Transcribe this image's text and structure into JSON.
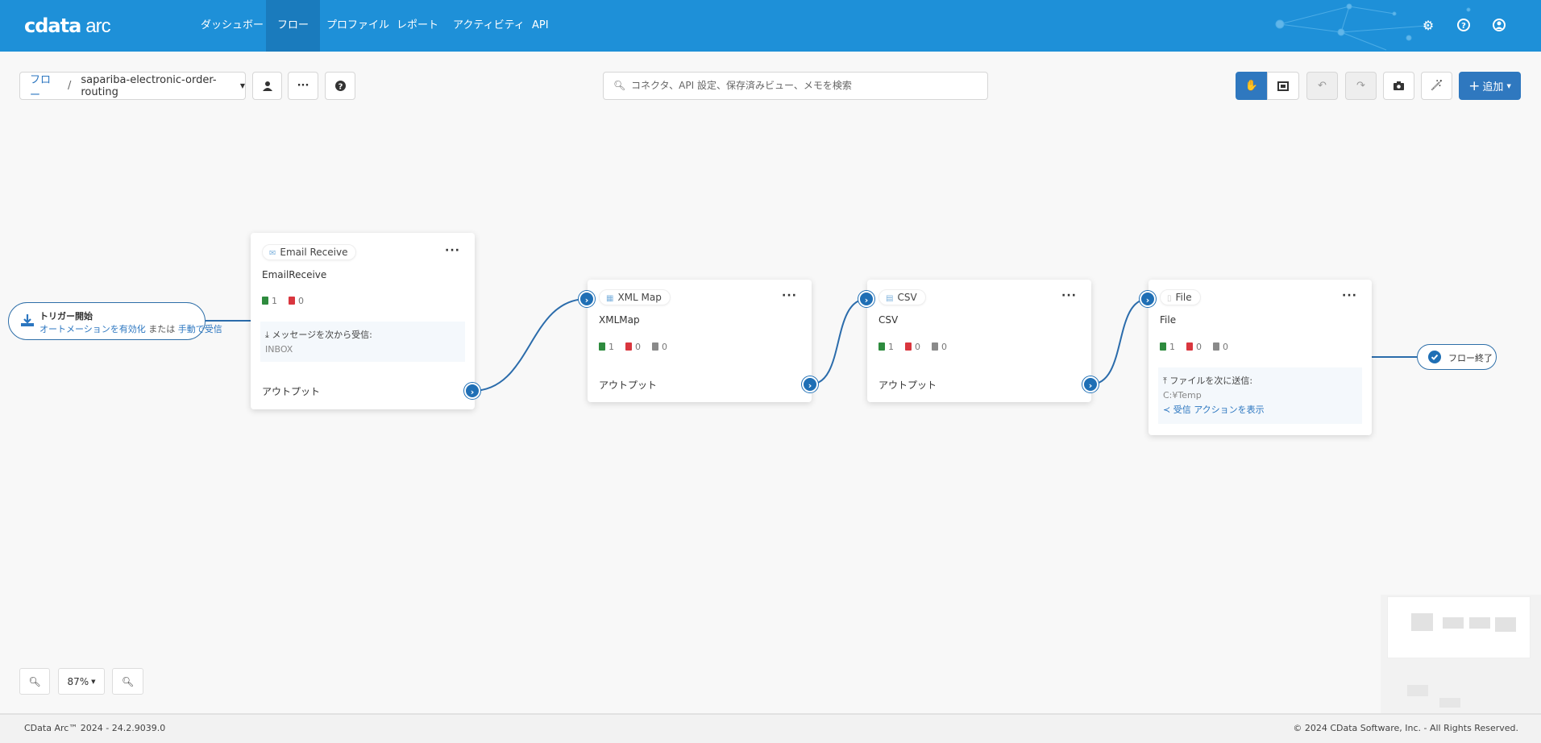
{
  "header": {
    "logo": "cdata",
    "logo_suffix": "arc",
    "nav": [
      {
        "label": "ダッシュボード"
      },
      {
        "label": "フロー",
        "active": true
      },
      {
        "label": "プロファイル"
      },
      {
        "label": "レポート"
      },
      {
        "label": "アクティビティ"
      },
      {
        "label": "API"
      }
    ],
    "icons": [
      "gear-icon",
      "help-icon",
      "user-circle-icon"
    ]
  },
  "toolbar": {
    "breadcrumb_root": "フロー",
    "breadcrumb_sep": "/",
    "flow_name": "sapariba-electronic-order-routing",
    "search_placeholder": "コネクタ、API 設定、保存済みビュー、メモを検索",
    "add_label": "追加"
  },
  "trigger": {
    "title": "トリガー開始",
    "link1": "オートメーションを有効化",
    "or": "または",
    "link2": "手動で受信"
  },
  "cards": [
    {
      "type": "Email Receive",
      "name": "EmailReceive",
      "success": "1",
      "error": "0",
      "info_label": "メッセージを次から受信:",
      "info_value": "INBOX",
      "output": "アウトプット"
    },
    {
      "type": "XML Map",
      "name": "XMLMap",
      "success": "1",
      "error": "0",
      "pending": "0",
      "output": "アウトプット"
    },
    {
      "type": "CSV",
      "name": "CSV",
      "success": "1",
      "error": "0",
      "pending": "0",
      "output": "アウトプット"
    },
    {
      "type": "File",
      "name": "File",
      "success": "1",
      "error": "0",
      "pending": "0",
      "info_label": "ファイルを次に送信:",
      "info_value": "C:¥Temp",
      "info_link": "受信 アクションを表示"
    }
  ],
  "end": {
    "label": "フロー終了"
  },
  "zoom": {
    "level": "87%"
  },
  "footer": {
    "version": "CData Arc™ 2024 - 24.2.9039.0",
    "copyright": "© 2024 CData Software, Inc. - All Rights Reserved."
  },
  "colors": {
    "header": "#1e90d8",
    "accent": "#2f78bf",
    "success": "#2e8b3e",
    "error": "#d9363e"
  }
}
